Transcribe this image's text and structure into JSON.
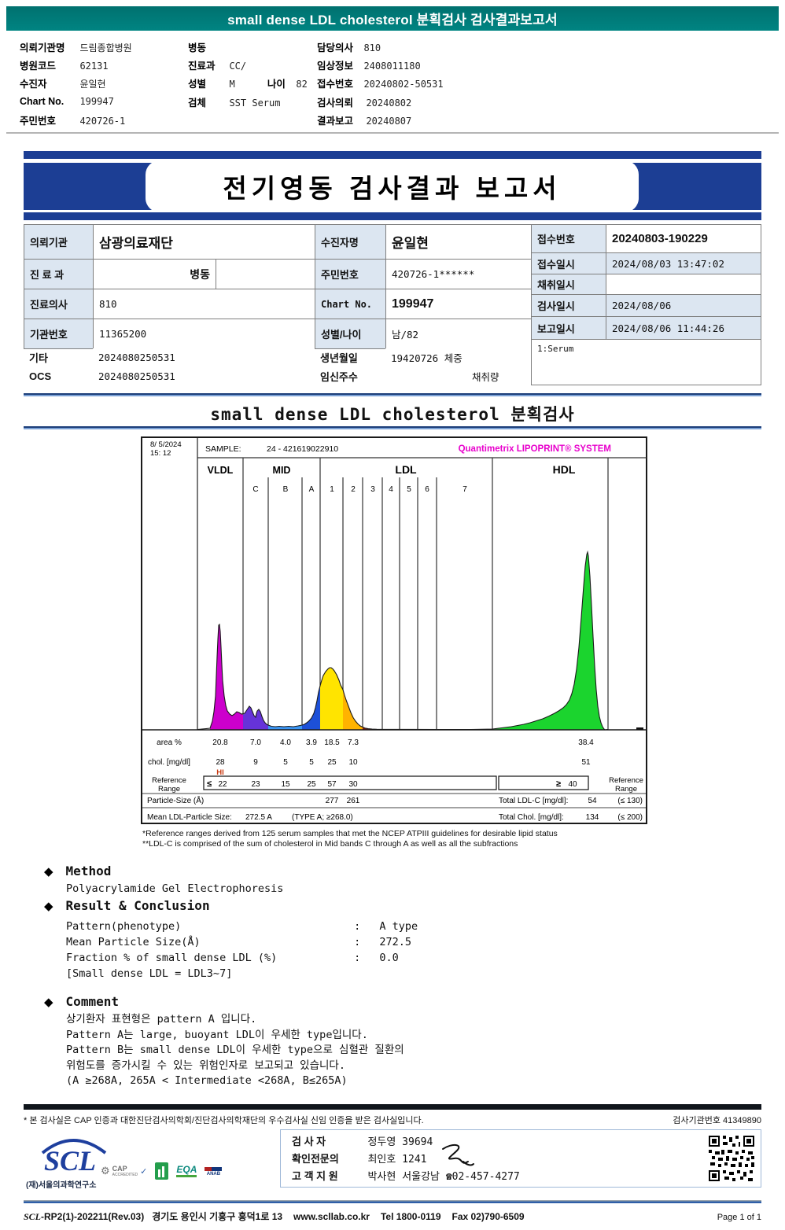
{
  "report_header": {
    "title": "small dense LDL cholesterol 분획검사 검사결과보고서",
    "col1": [
      {
        "label": "의뢰기관명",
        "value": "드림종합병원"
      },
      {
        "label": "병원코드",
        "value": "62131"
      },
      {
        "label": "수진자",
        "value": "윤일현"
      },
      {
        "label": "Chart No.",
        "value": "199947"
      },
      {
        "label": "주민번호",
        "value": "420726-1"
      }
    ],
    "col2": [
      {
        "label": "병동",
        "value": ""
      },
      {
        "label": "진료과",
        "value": "CC/"
      },
      {
        "label": "성별",
        "value": "M",
        "label2": "나이",
        "value2": "82"
      },
      {
        "label": "검체",
        "value": "SST Serum"
      }
    ],
    "col3": [
      {
        "label": "담당의사",
        "value": "810"
      },
      {
        "label": "임상정보",
        "value": "2408011180"
      },
      {
        "label": "접수번호",
        "value": "20240802-50531"
      },
      {
        "label": "검사의뢰",
        "value": "20240802"
      },
      {
        "label": "결과보고",
        "value": "20240807"
      }
    ]
  },
  "banner": {
    "title": "전기영동 검사결과 보고서"
  },
  "info_table": {
    "left_rows": [
      {
        "label": "의뢰기관",
        "value": "삼광의료재단"
      },
      {
        "label": "진 료 과",
        "value": "병동"
      },
      {
        "label": "진료의사",
        "value": "810"
      },
      {
        "label": "기관번호",
        "value": "11365200"
      },
      {
        "label": "기타",
        "value": "2024080250531"
      },
      {
        "label": "OCS",
        "value": "2024080250531"
      }
    ],
    "mid_rows": [
      {
        "label": "수진자명",
        "value": "윤일현"
      },
      {
        "label": "주민번호",
        "value": "420726-1******"
      },
      {
        "label": "Chart No.",
        "value": "199947"
      },
      {
        "label": "성별/나이",
        "value": "남/82"
      },
      {
        "label": "생년월일",
        "value": "19420726 체중"
      },
      {
        "label": "임신주수",
        "value": "채취량"
      }
    ],
    "right_rows": [
      {
        "label": "접수번호",
        "value": "20240803-190229"
      },
      {
        "label": "접수일시",
        "value": "2024/08/03 13:47:02"
      },
      {
        "label": "채취일시",
        "value": ""
      },
      {
        "label": "검사일시",
        "value": "2024/08/06"
      },
      {
        "label": "보고일시",
        "value": "2024/08/06 11:44:26"
      }
    ],
    "specimen": "1:Serum"
  },
  "section": {
    "title": "small dense LDL cholesterol 분획검사"
  },
  "chart": {
    "datetime1": "8/ 5/2024",
    "datetime2": "15: 12",
    "sample_label": "SAMPLE:",
    "sample_id": "24 - 421619022910",
    "brand": "Quantimetrix LIPOPRINT® SYSTEM",
    "groups": [
      "VLDL",
      "MID",
      "LDL",
      "HDL"
    ],
    "subbands": [
      "C",
      "B",
      "A",
      "1",
      "2",
      "3",
      "4",
      "5",
      "6",
      "7"
    ],
    "row_labels": {
      "area": "area %",
      "chol": "chol. [mg/dl]",
      "ref1": "Reference",
      "ref2": "Range",
      "particle": "Particle-Size (Å)",
      "mean": "Mean LDL-Particle Size:"
    },
    "area": [
      "20.8",
      "7.0",
      "4.0",
      "3.9",
      "18.5",
      "7.3",
      "38.4"
    ],
    "chol": [
      "28",
      "9",
      "5",
      "5",
      "25",
      "10",
      "51"
    ],
    "chol_flag": "HI",
    "ref_le": "≤",
    "ref": [
      "22",
      "23",
      "15",
      "25",
      "57",
      "30"
    ],
    "ref_ge": "≥",
    "ref_hdl": "40",
    "particle": [
      "277",
      "261"
    ],
    "total_ldl_label": "Total LDL-C [mg/dl]:",
    "total_ldl": "54",
    "total_ldl_ref": "(≤ 130)",
    "mean_value": "272.5 A",
    "mean_type": "(TYPE A; ≥268.0)",
    "total_chol_label": "Total Chol. [mg/dl]:",
    "total_chol": "134",
    "total_chol_ref": "(≤ 200)",
    "footnote1": "*Reference ranges derived from 125 serum samples that met the NCEP ATPIII guidelines for desirable lipid status",
    "footnote2": "**LDL-C is comprised of the sum of cholesterol in Mid bands C through A as well as all the subfractions"
  },
  "chart_data": {
    "type": "area",
    "title": "Lipoprint electrophoresis profile",
    "x_bands": [
      "VLDL",
      "MID C",
      "MID B",
      "MID A",
      "LDL1",
      "LDL2",
      "LDL3",
      "LDL4",
      "LDL5",
      "LDL6",
      "LDL7",
      "HDL"
    ],
    "series": [
      {
        "name": "VLDL",
        "color": "#cc00cc",
        "area_pct": 20.8,
        "chol_mg_dl": 28,
        "flag": "HI",
        "ref": "≤ 22"
      },
      {
        "name": "MID C",
        "color": "#6633d9",
        "area_pct": 7.0,
        "chol_mg_dl": 9,
        "ref": "23"
      },
      {
        "name": "MID B",
        "color": "#3b96f5",
        "area_pct": 4.0,
        "chol_mg_dl": 5,
        "ref": "15"
      },
      {
        "name": "MID A",
        "color": "#1d50d8",
        "area_pct": 3.9,
        "chol_mg_dl": 5,
        "ref": "25"
      },
      {
        "name": "LDL1",
        "color": "#ffe400",
        "area_pct": 18.5,
        "chol_mg_dl": 25,
        "ref": "57",
        "particle_size_A": 277
      },
      {
        "name": "LDL2",
        "color": "#ffb300",
        "area_pct": 7.3,
        "chol_mg_dl": 10,
        "ref": "30",
        "particle_size_A": 261
      },
      {
        "name": "LDL3-7",
        "color": "#8b1a10",
        "area_pct": 0.0,
        "chol_mg_dl": 0
      },
      {
        "name": "HDL",
        "color": "#1bd42e",
        "area_pct": 38.4,
        "chol_mg_dl": 51,
        "ref": "≥ 40"
      }
    ],
    "mean_ldl_particle_size_A": 272.5,
    "total_ldl_c_mg_dl": 54,
    "total_chol_mg_dl": 134
  },
  "method": {
    "bullet": "◆",
    "heading": "Method",
    "body": "Polyacrylamide Gel Electrophoresis"
  },
  "result": {
    "heading": "Result & Conclusion",
    "colon": ":",
    "rows": [
      {
        "label": "Pattern(phenotype)",
        "value": "A type"
      },
      {
        "label": "Mean Particle Size(Å)",
        "value": "272.5"
      },
      {
        "label": "Fraction % of small dense LDL (%)",
        "value": "0.0"
      }
    ],
    "note": "[Small dense LDL = LDL3~7]"
  },
  "comment": {
    "heading": "Comment",
    "lines": [
      "상기환자 표현형은 pattern A 입니다.",
      "Pattern A는 large, buoyant LDL이 우세한 type입니다.",
      "Pattern B는 small dense LDL이 우세한 type으로 심혈관 질환의",
      "위험도를 증가시킬 수 있는 위험인자로 보고되고 있습니다.",
      "(A ≥268A, 265A < Intermediate <268A, B≤265A)"
    ]
  },
  "footer": {
    "note": "* 본 검사실은 CAP 인증과 대한진단검사의학회/진단검사의학재단의 우수검사실 신임 인증을 받은 검사실입니다.",
    "org_no": "검사기관번호 41349890",
    "scl": "SCL",
    "scl_sub": "(재)서울의과학연구소",
    "cap1": "CAP",
    "cap2": "ACCREDITED",
    "eqa": "EQA",
    "anab": "ANAB",
    "sig_rows": [
      {
        "label": "검  사  자",
        "value": "정두영 39694"
      },
      {
        "label": "확인전문의",
        "value": "최인호 1241"
      },
      {
        "label": "고 객 지 원",
        "value": "박사현 서울강남 ☎02-457-4277"
      }
    ],
    "doc_code_scl": "SCL",
    "doc_code_rest": "-RP2(1)-202211(Rev.03)",
    "address": "경기도 용인시 기흥구 흥덕1로 13",
    "website": "www.scllab.co.kr",
    "tel": "Tel 1800-0119",
    "fax": "Fax 02)790-6509",
    "page": "Page 1 of 1"
  }
}
